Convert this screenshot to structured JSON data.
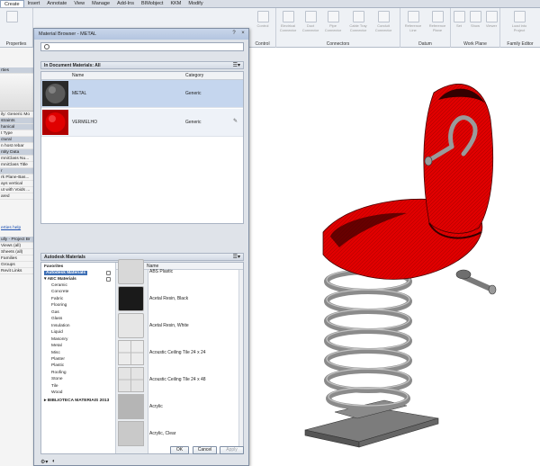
{
  "ribbon": {
    "tabs": [
      "Create",
      "Insert",
      "Annotate",
      "View",
      "Manage",
      "Add-Ins",
      "BIMobject",
      "KKM",
      "Modify"
    ],
    "active_tab": "Create",
    "groups": [
      {
        "label": "Properties"
      },
      {
        "label": "Control"
      },
      {
        "label": "Connectors"
      },
      {
        "label": "Datum"
      },
      {
        "label": "Work Plane"
      },
      {
        "label": "Family Editor"
      }
    ],
    "buttons": [
      "Control",
      "Electrical Connector",
      "Duct Connector",
      "Pipe Connector",
      "Cable Tray Connector",
      "Conduit Connector",
      "Reference Line",
      "Reference Plane",
      "Set",
      "Show",
      "Viewer",
      "Load into Project"
    ]
  },
  "left_panel": {
    "top_label": "rties",
    "family_label": "ily: Generic Mo",
    "rows": [
      "straints",
      "hanical",
      "t Type",
      "ctural",
      "n host rebar",
      "ntity Data",
      "mniClass Nu...",
      "mniClass Title",
      "r",
      "rk Plane-Bas...",
      "ays vertical",
      "ut with Voids ...",
      "ared"
    ],
    "link": "erties help",
    "browser_title": "ully - Project Br",
    "browser_items": [
      "Views (all)",
      "Sheets (all)",
      "Families",
      "Groups",
      "Revit Links"
    ]
  },
  "dialog": {
    "title": "Material Browser - METAL",
    "search_placeholder": "",
    "doc_section": "In Document Materials: All",
    "col_name": "Name",
    "col_category": "Category",
    "doc_materials": [
      {
        "name": "METAL",
        "category": "Generic"
      },
      {
        "name": "VERMELHO",
        "category": "Generic"
      }
    ],
    "lib_section": "Autodesk Materials",
    "tree": {
      "favorites": "Favorites",
      "autodesk_materials": "Autodesk Materials",
      "aec_materials": "AEC Materials",
      "categories": [
        "Ceramic",
        "Concrete",
        "Fabric",
        "Flooring",
        "Gas",
        "Glass",
        "Insulation",
        "Liquid",
        "Masonry",
        "Metal",
        "Misc",
        "Plaster",
        "Plastic",
        "Roofing",
        "Stone",
        "Tile",
        "Wood"
      ],
      "biblioteca": "BIBLIOTECA MATERIAIS 2013"
    },
    "lib_col_name": "Name",
    "lib_materials": [
      {
        "name": "ABS Plastic",
        "swatch": "#d8d8d8"
      },
      {
        "name": "Acetal Resin, Black",
        "swatch": "#1a1a1a"
      },
      {
        "name": "Acetal Resin, White",
        "swatch": "#e6e6e6"
      },
      {
        "name": "Acoustic Ceiling Tile 24 x 24",
        "swatch": "#ececec"
      },
      {
        "name": "Acoustic Ceiling Tile 24 x 48",
        "swatch": "#e4e4e4"
      },
      {
        "name": "Acrylic",
        "swatch": "#b5b5b5"
      },
      {
        "name": "Acrylic, Clear",
        "swatch": "#c9c9c9"
      }
    ],
    "buttons": {
      "ok": "OK",
      "cancel": "Cancel",
      "apply": "Apply"
    }
  },
  "colors": {
    "red_material": "#e00000",
    "metal_material": "#8a8a8a",
    "selection": "#c5d6ee",
    "tree_selection": "#3e6fb5"
  }
}
